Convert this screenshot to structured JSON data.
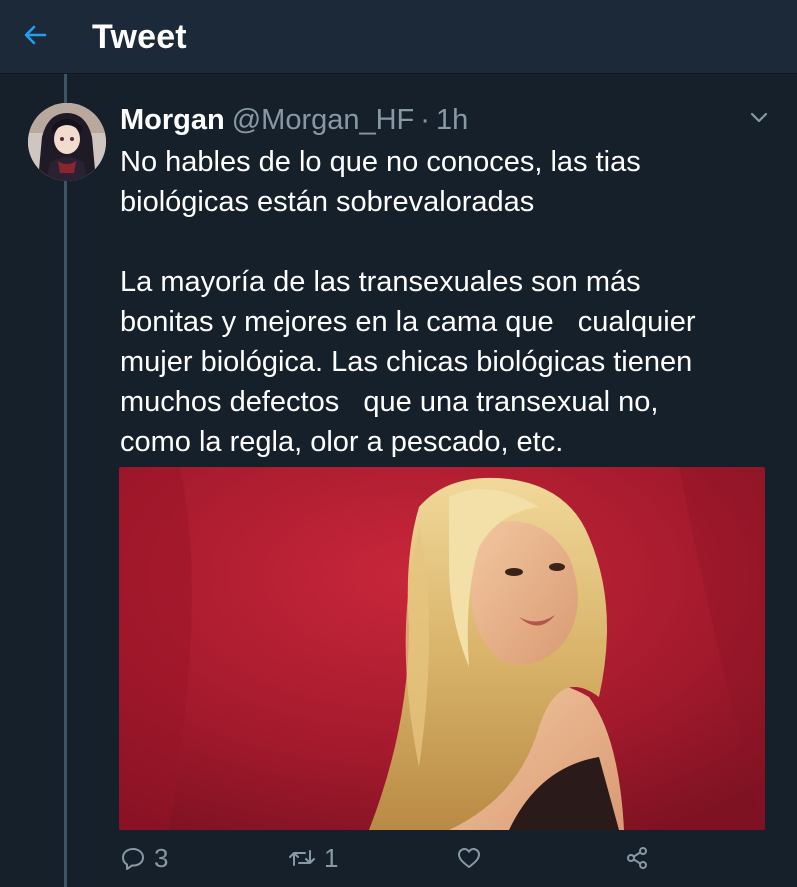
{
  "header": {
    "title": "Tweet",
    "back_icon": "arrow-left-icon"
  },
  "tweet": {
    "display_name": "Morgan",
    "handle": "@Morgan_HF",
    "separator": "·",
    "time": "1h",
    "text_lines": [
      "No hables de lo que no conoces, las tias",
      "biológicas están sobrevaloradas",
      "",
      "La mayoría de las transexuales son más",
      "bonitas y mejores en la cama que   cualquier",
      "mujer biológica. Las chicas biológicas tienen",
      "muchos defectos   que una transexual no,",
      "como la regla, olor a pescado, etc."
    ]
  },
  "actions": {
    "reply_count": "3",
    "retweet_count": "1"
  },
  "colors": {
    "background": "#15202b",
    "header_bg": "#1c2938",
    "accent": "#1da1f2",
    "muted": "#8899a6"
  }
}
